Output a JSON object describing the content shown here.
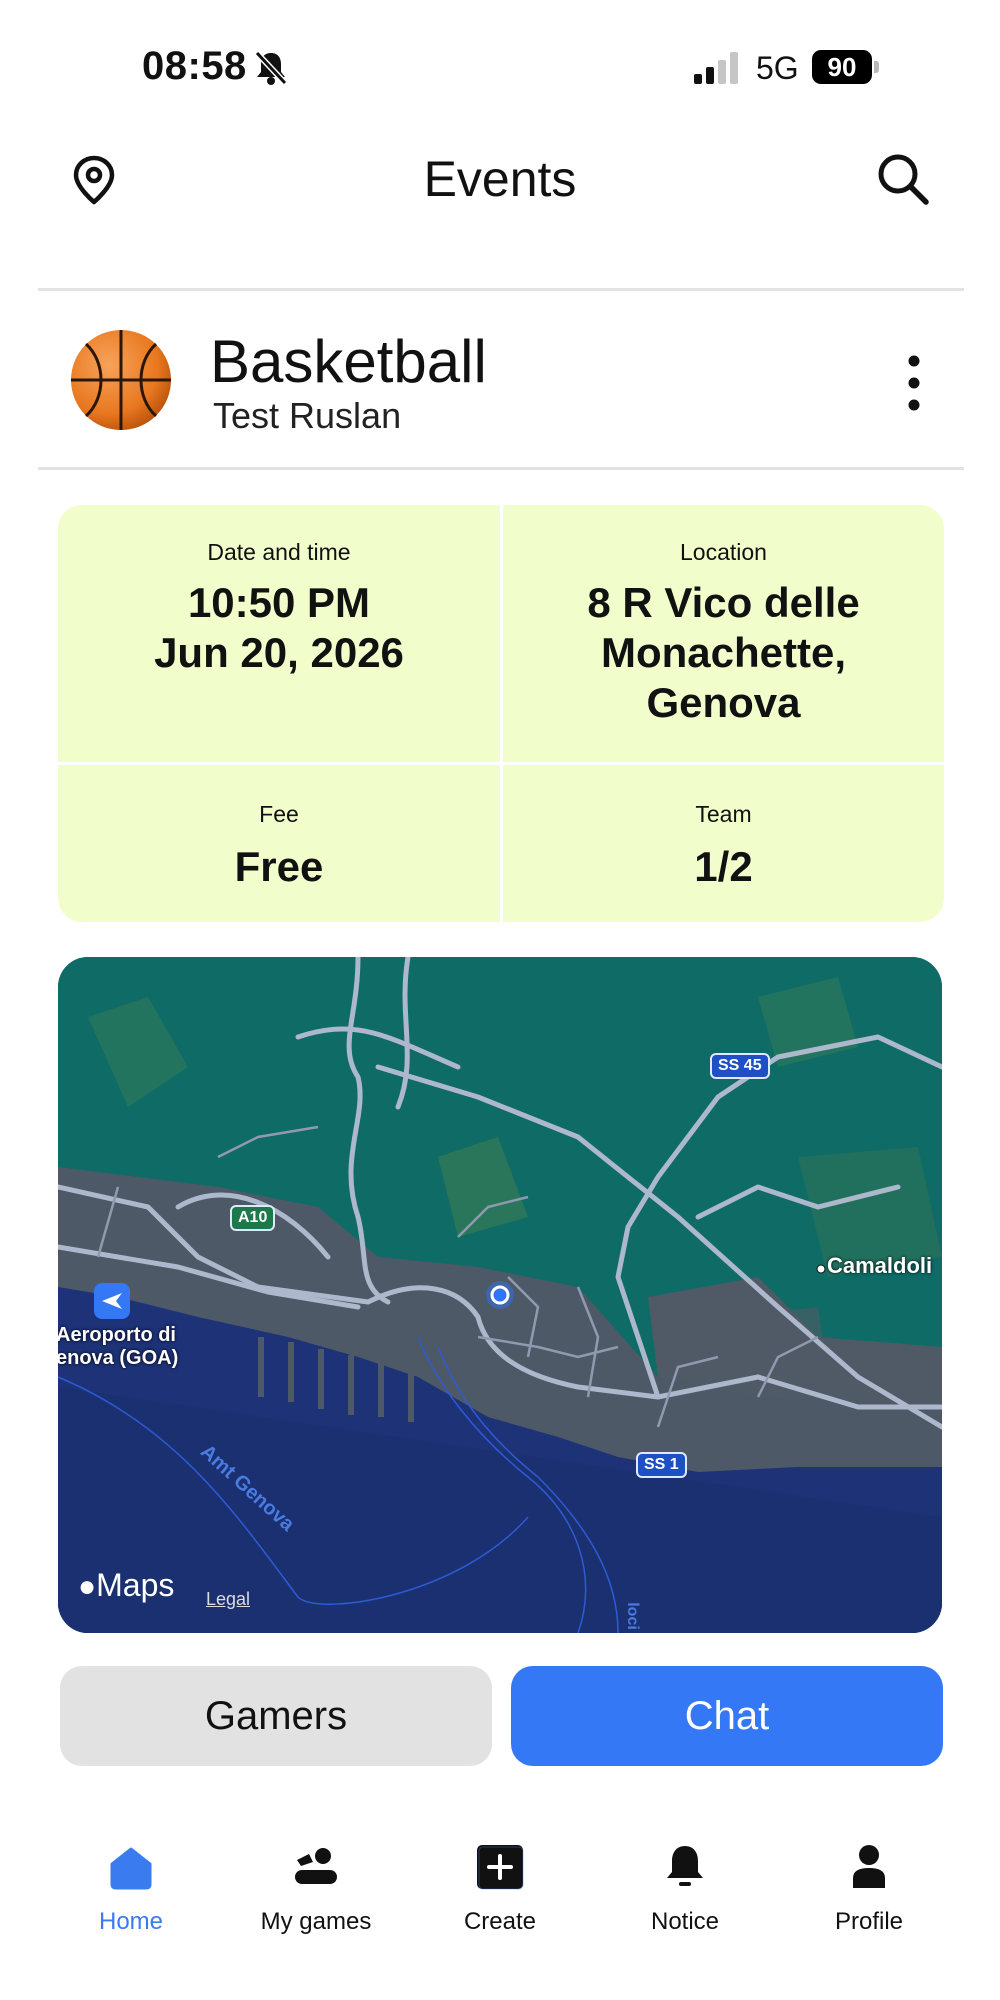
{
  "status_bar": {
    "time": "08:58",
    "network": "5G",
    "battery": "90"
  },
  "header": {
    "title": "Events",
    "left_icon": "location-pin-icon",
    "right_icon": "search-icon"
  },
  "event": {
    "title": "Basketball",
    "organizer": "Test Ruslan",
    "icon": "basketball-icon"
  },
  "info": {
    "datetime_label": "Date and time",
    "datetime_line1": "10:50 PM",
    "datetime_line2": "Jun 20, 2026",
    "location_label": "Location",
    "location_line1": "8 R Vico delle",
    "location_line2": "Monachette,",
    "location_line3": "Genova",
    "fee_label": "Fee",
    "fee_value": "Free",
    "team_label": "Team",
    "team_value": "1/2",
    "card_color": "#f1fecc"
  },
  "map": {
    "logo": "Maps",
    "legal": "Legal",
    "labels": {
      "camaldoli": "Camaldoli",
      "airport_line1": "Aeroporto di",
      "airport_line2": "enova (GOA)",
      "sea": "Amt Genova",
      "road_ss45": "SS 45",
      "road_a10": "A10",
      "road_ss1": "SS 1",
      "road_loci": "loci"
    }
  },
  "actions": {
    "gamers": "Gamers",
    "chat": "Chat",
    "accent": "#3478f6"
  },
  "tabs": [
    {
      "label": "Home",
      "icon": "home-icon",
      "active": true
    },
    {
      "label": "My games",
      "icon": "my-games-icon",
      "active": false
    },
    {
      "label": "Create",
      "icon": "create-plus-icon",
      "active": false
    },
    {
      "label": "Notice",
      "icon": "bell-icon",
      "active": false
    },
    {
      "label": "Profile",
      "icon": "profile-icon",
      "active": false
    }
  ]
}
